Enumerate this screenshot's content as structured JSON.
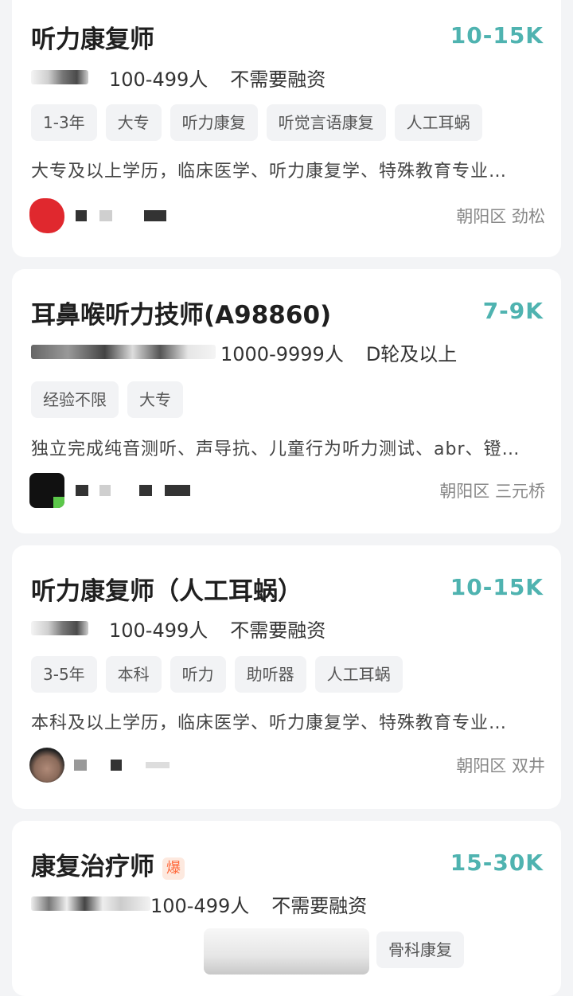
{
  "jobs": [
    {
      "title": "听力康复师",
      "salary": "10-15K",
      "company_size": "100-499人",
      "funding": "不需要融资",
      "tags": [
        "1-3年",
        "大专",
        "听力康复",
        "听觉言语康复",
        "人工耳蜗"
      ],
      "description": "大专及以上学历，临床医学、听力康复学、特殊教育专业…",
      "location": "朝阳区 劲松",
      "avatar_color": "#e0282e"
    },
    {
      "title": "耳鼻喉听力技师(A98860)",
      "salary": "7-9K",
      "company_size": "1000-9999人",
      "funding": "D轮及以上",
      "tags": [
        "经验不限",
        "大专"
      ],
      "description": "独立完成纯音测听、声导抗、儿童行为听力测试、abr、镫…",
      "location": "朝阳区 三元桥",
      "avatar_color": "#111111"
    },
    {
      "title": "听力康复师（人工耳蜗）",
      "salary": "10-15K",
      "company_size": "100-499人",
      "funding": "不需要融资",
      "tags": [
        "3-5年",
        "本科",
        "听力",
        "助听器",
        "人工耳蜗"
      ],
      "description": "本科及以上学历，临床医学、听力康复学、特殊教育专业…",
      "location": "朝阳区 双井",
      "avatar_color": "#8a6a5a"
    },
    {
      "title": "康复治疗师",
      "hot_badge": "爆",
      "salary": "15-30K",
      "company_size": "100-499人",
      "funding": "不需要融资",
      "tags": [
        "骨科康复"
      ]
    }
  ],
  "colors": {
    "salary": "#4fb3b0",
    "hot_badge": "#ff6a3d",
    "background": "#f3f4f6"
  }
}
